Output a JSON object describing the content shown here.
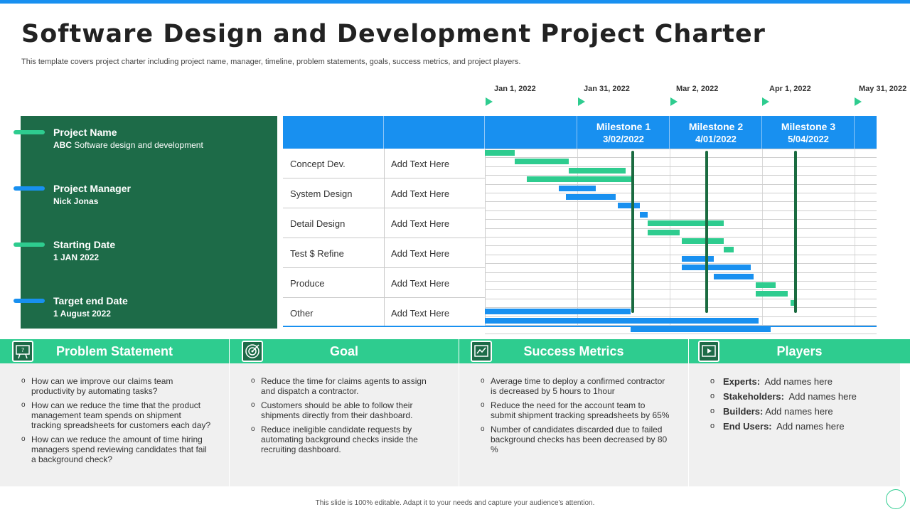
{
  "colors": {
    "blue": "#1890f0",
    "green": "#2ecc8f",
    "dark_green": "#1d6b48",
    "milestone_line": "#1a6b40"
  },
  "title": "Software Design and Development Project Charter",
  "subtitle": "This template covers project charter including project name, manager, timeline, problem statements, goals, success metrics, and project players.",
  "info": [
    {
      "label": "Project Name",
      "value_bold": "ABC",
      "value": " Software design and development",
      "bar_color": "green"
    },
    {
      "label": "Project Manager",
      "value_bold": "",
      "value": "Nick Jonas",
      "bar_color": "blue"
    },
    {
      "label": "Starting Date",
      "value_bold": "",
      "value": "1 JAN 2022",
      "bar_color": "green"
    },
    {
      "label": "Target end Date",
      "value_bold": "",
      "value": "1 August 2022",
      "bar_color": "blue"
    }
  ],
  "timeline_dates": [
    "Jan 1, 2022",
    "Jan 31, 2022",
    "Mar 2, 2022",
    "Apr 1, 2022",
    "May 31, 2022"
  ],
  "milestones": [
    {
      "title": "Milestone 1",
      "date": "3/02/2022"
    },
    {
      "title": "Milestone 2",
      "date": "4/01/2022"
    },
    {
      "title": "Milestone 3",
      "date": "5/04/2022"
    }
  ],
  "rows": [
    {
      "phase": "Concept Dev.",
      "text": "Add Text Here"
    },
    {
      "phase": "System Design",
      "text": "Add Text Here"
    },
    {
      "phase": "Detail Design",
      "text": "Add Text Here"
    },
    {
      "phase": "Test $ Refine",
      "text": "Add Text Here"
    },
    {
      "phase": "Produce",
      "text": "Add Text Here"
    },
    {
      "phase": "Other",
      "text": "Add Text Here"
    }
  ],
  "gantt_tasks": [
    {
      "start": "2022-01-01",
      "end": "2022-01-13",
      "color": "green"
    },
    {
      "start": "2022-01-13",
      "end": "2022-02-04",
      "color": "green"
    },
    {
      "start": "2022-02-04",
      "end": "2022-02-27",
      "color": "green"
    },
    {
      "start": "2022-01-18",
      "end": "2022-03-02",
      "color": "green"
    },
    {
      "start": "2022-01-31",
      "end": "2022-02-15",
      "color": "blue"
    },
    {
      "start": "2022-02-03",
      "end": "2022-02-23",
      "color": "blue"
    },
    {
      "start": "2022-02-24",
      "end": "2022-03-05",
      "color": "blue"
    },
    {
      "start": "2022-03-05",
      "end": "2022-03-08",
      "color": "blue"
    },
    {
      "start": "2022-03-08",
      "end": "2022-04-08",
      "color": "green"
    },
    {
      "start": "2022-03-08",
      "end": "2022-03-21",
      "color": "green"
    },
    {
      "start": "2022-03-22",
      "end": "2022-04-08",
      "color": "green"
    },
    {
      "start": "2022-04-08",
      "end": "2022-04-12",
      "color": "green"
    },
    {
      "start": "2022-03-22",
      "end": "2022-04-04",
      "color": "blue"
    },
    {
      "start": "2022-03-22",
      "end": "2022-04-19",
      "color": "blue"
    },
    {
      "start": "2022-04-04",
      "end": "2022-04-20",
      "color": "blue"
    },
    {
      "start": "2022-04-21",
      "end": "2022-04-29",
      "color": "green"
    },
    {
      "start": "2022-04-21",
      "end": "2022-05-04",
      "color": "green"
    },
    {
      "start": "2022-05-05",
      "end": "2022-05-07",
      "color": "green"
    },
    {
      "start": "2022-01-01",
      "end": "2022-03-01",
      "color": "blue"
    },
    {
      "start": "2022-01-01",
      "end": "2022-04-22",
      "color": "blue"
    },
    {
      "start": "2022-03-01",
      "end": "2022-04-27",
      "color": "blue"
    }
  ],
  "sections": [
    {
      "title": "Problem Statement",
      "icon": "problem-board-icon",
      "color": "green",
      "bullets": [
        "How can we improve our claims team productivity by automating tasks?",
        "How can we reduce the time that the product management team spends on shipment tracking spreadsheets for customers each day?",
        "How can we reduce the amount of time hiring managers spend reviewing candidates that fail a background check?"
      ]
    },
    {
      "title": "Goal",
      "icon": "target-icon",
      "color": "green",
      "bullets": [
        "Reduce the time for claims agents to assign and dispatch a contractor.",
        "Customers should be able to follow their shipments directly from their dashboard.",
        "Reduce ineligible candidate requests by automating background checks inside the recruiting dashboard."
      ]
    },
    {
      "title": "Success Metrics",
      "icon": "chart-icon",
      "color": "green",
      "bullets": [
        "Average time to deploy a confirmed contractor is decreased by 5 hours to 1hour",
        "Reduce the need for the account team to submit shipment tracking spreadsheets by 65%",
        "Number of candidates discarded due to failed background checks has been decreased by 80 %"
      ]
    },
    {
      "title": "Players",
      "icon": "video-play-icon",
      "color": "green",
      "players": [
        {
          "role": "Experts:",
          "names": "Add names here"
        },
        {
          "role": "Stakeholders:",
          "names": "Add names here"
        },
        {
          "role": "Builders:",
          "names": "Add names here"
        },
        {
          "role": "End Users:",
          "names": "Add names here"
        }
      ]
    }
  ],
  "footer": "This slide is 100% editable. Adapt it to your needs and capture your audience's attention."
}
